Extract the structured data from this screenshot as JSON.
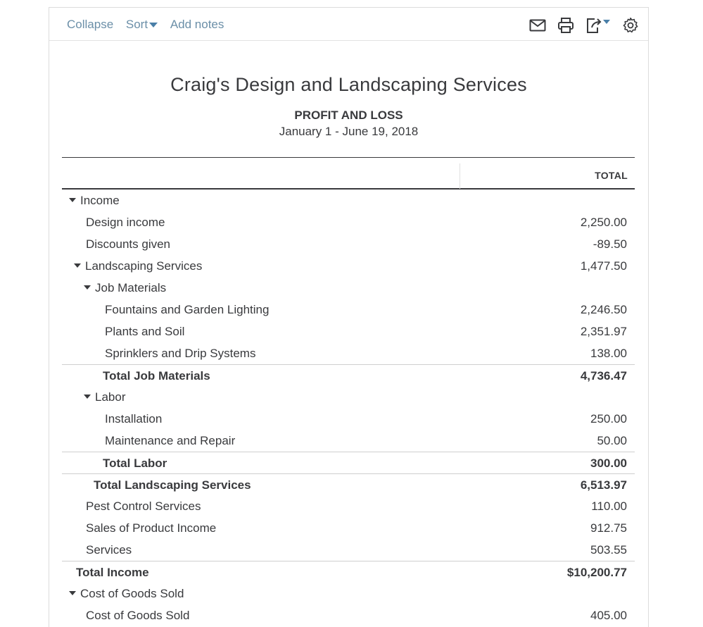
{
  "toolbar": {
    "collapse": "Collapse",
    "sort": "Sort",
    "add_notes": "Add notes",
    "icons": [
      "email-icon",
      "print-icon",
      "export-icon",
      "settings-icon"
    ]
  },
  "report": {
    "company": "Craig's Design and Landscaping Services",
    "title": "PROFIT AND LOSS",
    "date_range": "January 1 - June 19, 2018",
    "column_total": "TOTAL"
  },
  "rows": [
    {
      "label": "Income",
      "value": ""
    },
    {
      "label": "Design income",
      "value": "2,250.00"
    },
    {
      "label": "Discounts given",
      "value": "-89.50"
    },
    {
      "label": "Landscaping Services",
      "value": "1,477.50"
    },
    {
      "label": "Job Materials",
      "value": ""
    },
    {
      "label": "Fountains and Garden Lighting",
      "value": "2,246.50"
    },
    {
      "label": "Plants and Soil",
      "value": "2,351.97"
    },
    {
      "label": "Sprinklers and Drip Systems",
      "value": "138.00"
    },
    {
      "label": "Total Job Materials",
      "value": "4,736.47"
    },
    {
      "label": "Labor",
      "value": ""
    },
    {
      "label": "Installation",
      "value": "250.00"
    },
    {
      "label": "Maintenance and Repair",
      "value": "50.00"
    },
    {
      "label": "Total Labor",
      "value": "300.00"
    },
    {
      "label": "Total Landscaping Services",
      "value": "6,513.97"
    },
    {
      "label": "Pest Control Services",
      "value": "110.00"
    },
    {
      "label": "Sales of Product Income",
      "value": "912.75"
    },
    {
      "label": "Services",
      "value": "503.55"
    },
    {
      "label": "Total Income",
      "value": "$10,200.77"
    },
    {
      "label": "Cost of Goods Sold",
      "value": ""
    },
    {
      "label": "Cost of Goods Sold",
      "value": "405.00"
    }
  ]
}
